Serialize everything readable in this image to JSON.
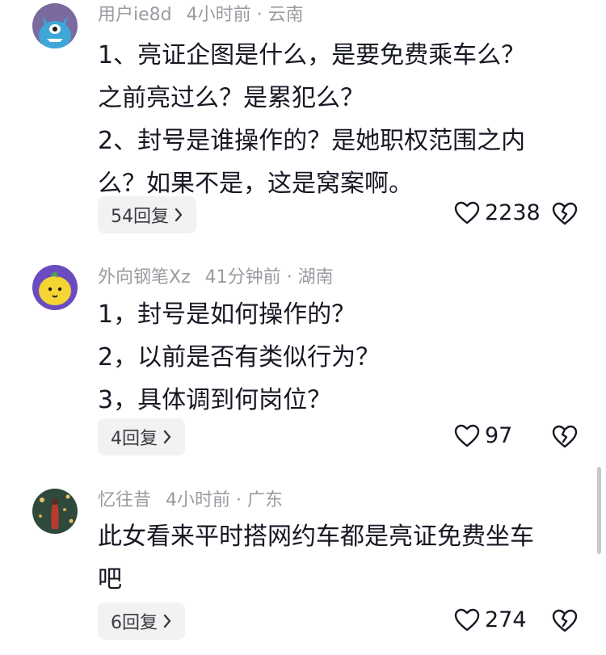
{
  "comments": [
    {
      "username": "用户ie8d",
      "time": "4小时前",
      "dot": "·",
      "location": "云南",
      "lines": [
        "1、亮证企图是什么，是要免费乘车么？",
        "之前亮过么？是累犯么？",
        "2、封号是谁操作的？是她职权范围之内",
        "么？如果不是，这是窝案啊。"
      ],
      "reply_label": "54回复",
      "likes": "2238",
      "avatar_icon": "blue-monster-avatar-icon"
    },
    {
      "username": "外向钢笔Xz",
      "time": "41分钟前",
      "dot": "·",
      "location": "湖南",
      "lines": [
        "1，封号是如何操作的？",
        "2，以前是否有类似行为？",
        "3，具体调到何岗位？"
      ],
      "reply_label": "4回复",
      "likes": "97",
      "avatar_icon": "lemon-avatar-icon"
    },
    {
      "username": "忆往昔",
      "time": "4小时前",
      "dot": "·",
      "location": "广东",
      "lines": [
        "此女看来平时搭网约车都是亮证免费坐车",
        "吧"
      ],
      "reply_label": "6回复",
      "likes": "274",
      "avatar_icon": "photo-avatar-icon"
    }
  ],
  "colors": {
    "meta_text": "#9a9ba1",
    "body_text": "#161823",
    "reply_bg": "#f2f2f3"
  }
}
